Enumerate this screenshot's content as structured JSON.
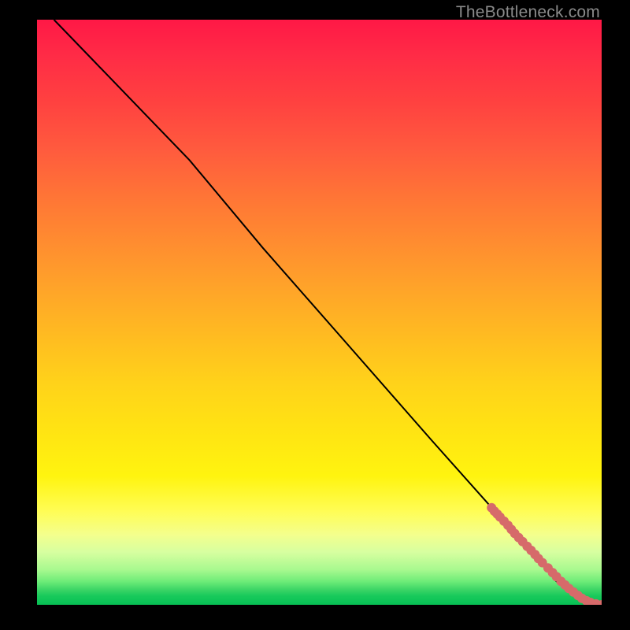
{
  "watermark": "TheBottleneck.com",
  "colors": {
    "curve": "#000000",
    "points": "#d66a6a"
  },
  "chart_data": {
    "type": "line",
    "title": "",
    "xlabel": "",
    "ylabel": "",
    "xlim": [
      0,
      100
    ],
    "ylim": [
      0,
      100
    ],
    "grid": false,
    "series": [
      {
        "name": "curve",
        "x": [
          3,
          10,
          20,
          27,
          40,
          55,
          70,
          82,
          88,
          92,
          95,
          97.5,
          99,
          100
        ],
        "y": [
          100,
          93,
          83,
          76,
          61,
          44.5,
          28,
          15,
          8.5,
          4,
          1.7,
          0.7,
          0.2,
          0
        ]
      }
    ],
    "scatter": [
      {
        "name": "points",
        "x": [
          80.5,
          81.0,
          81.5,
          82.0,
          82.7,
          83.4,
          84.0,
          84.6,
          85.3,
          86.0,
          86.8,
          87.5,
          88.2,
          88.8,
          89.5,
          90.5,
          91.3,
          92.0,
          92.8,
          93.5,
          94.2,
          95.0,
          95.8,
          96.5,
          97.3,
          98.0,
          99.0,
          100.0
        ],
        "y": [
          16.6,
          16.0,
          15.5,
          15.0,
          14.3,
          13.6,
          12.9,
          12.2,
          11.5,
          10.8,
          10.0,
          9.3,
          8.6,
          7.9,
          7.2,
          6.3,
          5.5,
          4.8,
          4.0,
          3.4,
          2.8,
          2.2,
          1.6,
          1.1,
          0.7,
          0.4,
          0.15,
          0.0
        ]
      }
    ]
  }
}
